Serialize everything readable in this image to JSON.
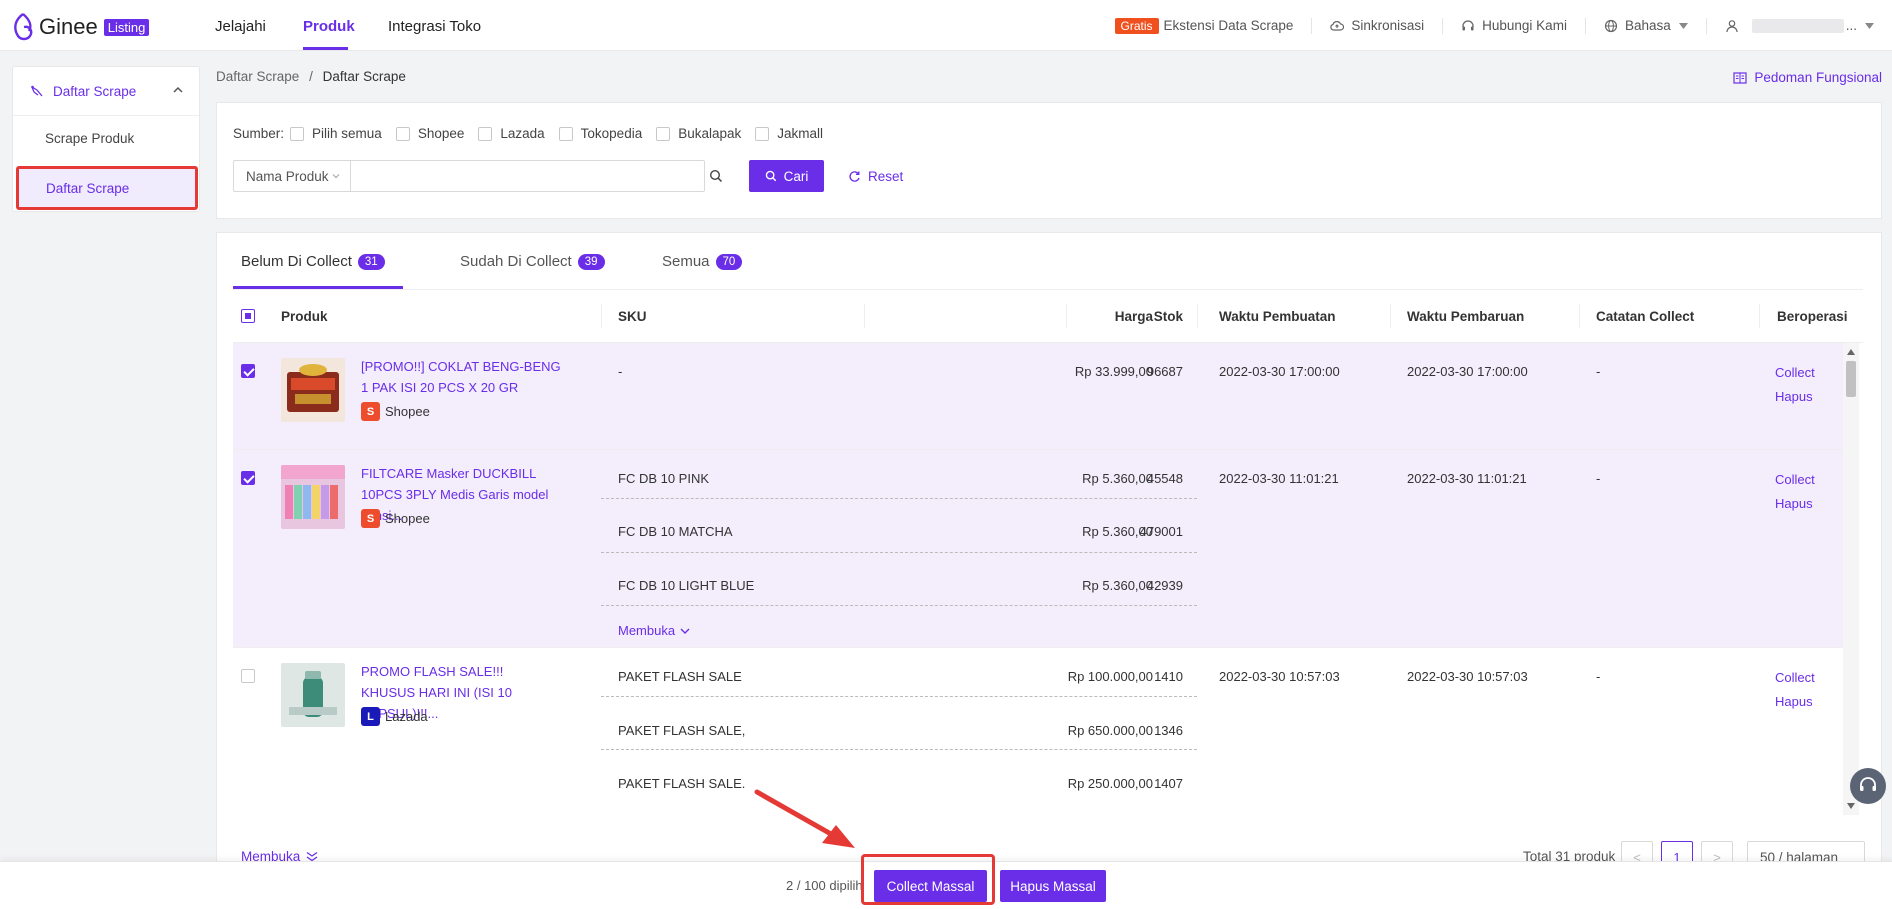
{
  "brand": {
    "name": "Ginee",
    "badge": "Listing",
    "color": "#6a2ee8"
  },
  "topnav": {
    "tabs": [
      {
        "label": "Jelajahi",
        "active": false
      },
      {
        "label": "Produk",
        "active": true
      },
      {
        "label": "Integrasi Toko",
        "active": false
      }
    ],
    "right": {
      "extension_badge": "Gratis",
      "extension_label": "Ekstensi Data Scrape",
      "sync_label": "Sinkronisasi",
      "contact_label": "Hubungi Kami",
      "language_label": "Bahasa",
      "user_label": "..."
    }
  },
  "sidebar": {
    "group_label": "Daftar Scrape",
    "items": [
      {
        "label": "Scrape Produk",
        "active": false
      },
      {
        "label": "Daftar Scrape",
        "active": true
      }
    ]
  },
  "breadcrumb": {
    "parent": "Daftar Scrape",
    "separator": "/",
    "current": "Daftar Scrape"
  },
  "pedoman_label": "Pedoman Fungsional",
  "filters": {
    "source_label": "Sumber:",
    "sources": [
      "Pilih semua",
      "Shopee",
      "Lazada",
      "Tokopedia",
      "Bukalapak",
      "Jakmall"
    ],
    "field_select": "Nama Produk",
    "search_value": "",
    "search_button": "Cari",
    "reset_button": "Reset"
  },
  "tabs": [
    {
      "label": "Belum Di Collect",
      "count": "31",
      "active": true
    },
    {
      "label": "Sudah Di Collect",
      "count": "39",
      "active": false
    },
    {
      "label": "Semua",
      "count": "70",
      "active": false
    }
  ],
  "columns": {
    "produk": "Produk",
    "sku": "SKU",
    "harga": "Harga",
    "stok": "Stok",
    "created": "Waktu Pembuatan",
    "updated": "Waktu Pembaruan",
    "note": "Catatan Collect",
    "ops": "Beroperasi"
  },
  "rows": [
    {
      "selected": true,
      "title": "[PROMO!!] COKLAT BENG-BENG 1 PAK ISI 20 PCS X 20 GR",
      "source": "Shopee",
      "variants": [
        {
          "sku": "-",
          "price": "Rp 33.999,00",
          "stock": "96687"
        }
      ],
      "created": "2022-03-30 17:00:00",
      "updated": "2022-03-30 17:00:00",
      "note": "-"
    },
    {
      "selected": true,
      "title": "FILTCARE Masker DUCKBILL 10PCS 3PLY Medis Garis model sensi...",
      "source": "Shopee",
      "variants": [
        {
          "sku": "FC DB 10 PINK",
          "price": "Rp 5.360,00",
          "stock": "45548"
        },
        {
          "sku": "FC DB 10 MATCHA",
          "price": "Rp 5.360,00",
          "stock": "479001"
        },
        {
          "sku": "FC DB 10 LIGHT BLUE",
          "price": "Rp 5.360,00",
          "stock": "42939"
        }
      ],
      "expand_label": "Membuka",
      "created": "2022-03-30 11:01:21",
      "updated": "2022-03-30 11:01:21",
      "note": "-"
    },
    {
      "selected": false,
      "title": "PROMO FLASH SALE!!! KHUSUS HARI INI (ISI 10 KAPSUL)!!!...",
      "source": "Lazada",
      "variants": [
        {
          "sku": "PAKET FLASH SALE",
          "price": "Rp 100.000,00",
          "stock": "1410"
        },
        {
          "sku": "PAKET FLASH SALE,",
          "price": "Rp 650.000,00",
          "stock": "1346"
        },
        {
          "sku": "PAKET FLASH SALE.",
          "price": "Rp 250.000,00",
          "stock": "1407"
        }
      ],
      "created": "2022-03-30 10:57:03",
      "updated": "2022-03-30 10:57:03",
      "note": "-"
    }
  ],
  "row_ops": {
    "collect": "Collect",
    "delete": "Hapus"
  },
  "footer": {
    "expand_label": "Membuka",
    "total": "Total 31 produk",
    "page": "1",
    "prev": "<",
    "next": ">",
    "per_page": "50 / halaman"
  },
  "bottombar": {
    "selected_count": "2 / 100 dipilih",
    "collect_all": "Collect Massal",
    "delete_all": "Hapus Massal"
  }
}
